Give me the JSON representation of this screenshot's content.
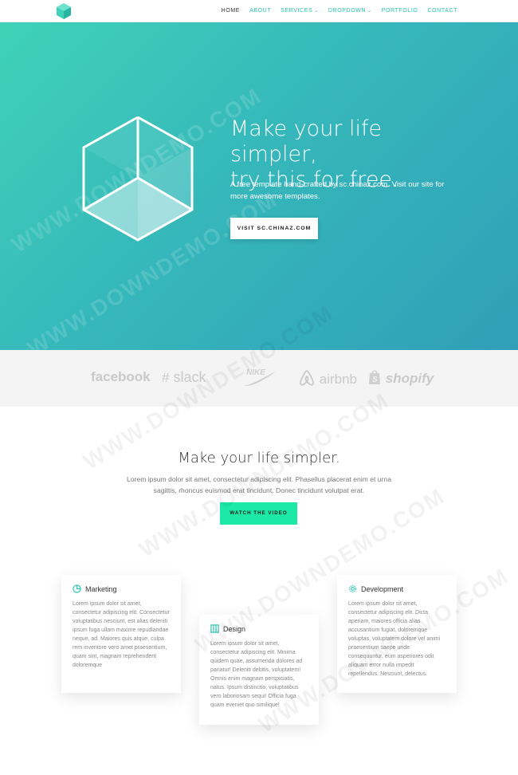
{
  "nav": {
    "items": [
      {
        "label": "HOME",
        "active": true
      },
      {
        "label": "ABOUT"
      },
      {
        "label": "SERVICES",
        "caret": "⌄"
      },
      {
        "label": "DROPDOWN",
        "caret": "⌄"
      },
      {
        "label": "PORTFOLIO"
      },
      {
        "label": "CONTACT"
      }
    ]
  },
  "hero": {
    "title_line1": "Make your life simpler,",
    "title_line2": "try this for free.",
    "subtitle": "A free template hand-crafted by sc.chinaz.com. Visit our site for more awesome templates.",
    "button_label": "VISIT SC.CHINAZ.COM"
  },
  "brands": {
    "facebook": "facebook",
    "slack": "slack",
    "nike": "NIKE",
    "airbnb": "airbnb",
    "shopify": "shopify"
  },
  "section2": {
    "title": "Make your life simpler.",
    "text": "Lorem ipsum dolor sit amet, consectetur adipiscing elit. Phasellus placerat enim et urna sagittis, rhoncus euismod erat tincidunt. Donec tincidunt volutpat erat.",
    "button_label": "WATCH THE VIDEO"
  },
  "cards": {
    "marketing": {
      "title": "Marketing",
      "text": "Lorem ipsum dolor sit amet, consectetur adipiscing elit. Consectetur voluptatibus nesciunt, est alias deleniti ipsum fuga ullam maxime repudiandae neque, ad. Maiores quis atque, culpa rem inventore vero amet praesentium, quam sint, magnam reprehenderit doloremque"
    },
    "design": {
      "title": "Design",
      "text": "Lorem ipsum dolor sit amet, consectetur adipiscing elit. Minima quidem quae, assumenda dolores ad pariatur! Deleniti debitis, voluptatem! Omnis enim magnam perspiciatis, natus. Ipsum distinctio, voluptatibus vero laboriosam sequi! Officia fuga quam eveniet quo similique!"
    },
    "development": {
      "title": "Development",
      "text": "Lorem ipsum dolor sit amet, consectetur adipiscing elit. Dicta aperiam, maiores officia alias accusantium fugiat, doloremque voluptas, voluptatem dolore vel animi praesentium saepe unde consequuntur, eum asperiores odit aliquam error nulla impedit repellendus. Nesciunt, delectus."
    }
  },
  "watermark": "WWW.DOWNDEMO.COM",
  "colors": {
    "accent": "#27c2b0",
    "button_green": "#1de9a6",
    "hero_start": "#3fd2b8",
    "hero_end": "#2f9fb8"
  }
}
